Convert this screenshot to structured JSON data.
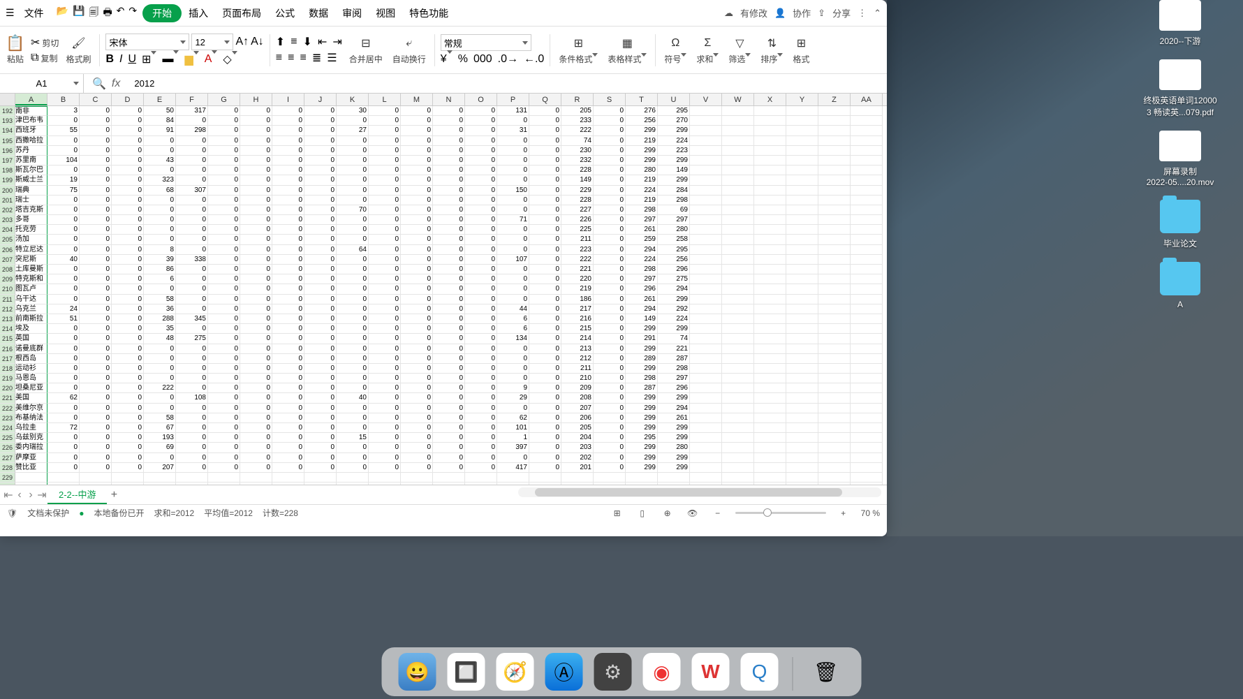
{
  "menu": {
    "file": "文件",
    "start": "开始",
    "insert": "插入",
    "layout": "页面布局",
    "formula": "公式",
    "data": "数据",
    "review": "审阅",
    "view": "视图",
    "feature": "特色功能",
    "hasChange": "有修改",
    "coop": "协作",
    "share": "分享"
  },
  "ribbon": {
    "paste": "粘贴",
    "cut": "剪切",
    "copy": "复制",
    "format": "格式刷",
    "font": "宋体",
    "size": "12",
    "merge": "合并居中",
    "wrap": "自动换行",
    "numfmt": "常规",
    "condfmt": "条件格式",
    "tablefmt": "表格样式",
    "symbol": "符号",
    "sum": "求和",
    "filter": "筛选",
    "sort": "排序",
    "fmt": "格式"
  },
  "namebox": "A1",
  "formula": "2012",
  "cols": [
    "A",
    "B",
    "C",
    "D",
    "E",
    "F",
    "G",
    "H",
    "I",
    "J",
    "K",
    "L",
    "M",
    "N",
    "O",
    "P",
    "Q",
    "R",
    "S",
    "T",
    "U",
    "V",
    "W",
    "X",
    "Y",
    "Z",
    "AA"
  ],
  "rowStart": 192,
  "rowData": [
    {
      "a": "南非",
      "v": [
        3,
        0,
        0,
        50,
        317,
        0,
        0,
        0,
        0,
        30,
        0,
        0,
        0,
        0,
        131,
        0,
        205,
        0,
        276,
        295
      ]
    },
    {
      "a": "津巴布韦",
      "v": [
        0,
        0,
        0,
        84,
        0,
        0,
        0,
        0,
        0,
        0,
        0,
        0,
        0,
        0,
        0,
        0,
        233,
        0,
        256,
        270
      ]
    },
    {
      "a": "西班牙",
      "v": [
        55,
        0,
        0,
        91,
        298,
        0,
        0,
        0,
        0,
        27,
        0,
        0,
        0,
        0,
        31,
        0,
        222,
        0,
        299,
        299
      ]
    },
    {
      "a": "西撒哈拉",
      "v": [
        0,
        0,
        0,
        0,
        0,
        0,
        0,
        0,
        0,
        0,
        0,
        0,
        0,
        0,
        0,
        0,
        74,
        0,
        219,
        224
      ]
    },
    {
      "a": "苏丹",
      "v": [
        0,
        0,
        0,
        0,
        0,
        0,
        0,
        0,
        0,
        0,
        0,
        0,
        0,
        0,
        0,
        0,
        230,
        0,
        299,
        223
      ]
    },
    {
      "a": "苏里南",
      "v": [
        104,
        0,
        0,
        43,
        0,
        0,
        0,
        0,
        0,
        0,
        0,
        0,
        0,
        0,
        0,
        0,
        232,
        0,
        299,
        299
      ]
    },
    {
      "a": "斯瓦尔巴",
      "v": [
        0,
        0,
        0,
        0,
        0,
        0,
        0,
        0,
        0,
        0,
        0,
        0,
        0,
        0,
        0,
        0,
        228,
        0,
        280,
        149
      ]
    },
    {
      "a": "斯威士兰",
      "v": [
        19,
        0,
        0,
        323,
        0,
        0,
        0,
        0,
        0,
        0,
        0,
        0,
        0,
        0,
        0,
        0,
        149,
        0,
        219,
        299
      ]
    },
    {
      "a": "瑞典",
      "v": [
        75,
        0,
        0,
        68,
        307,
        0,
        0,
        0,
        0,
        0,
        0,
        0,
        0,
        0,
        150,
        0,
        229,
        0,
        224,
        284
      ]
    },
    {
      "a": "瑞士",
      "v": [
        0,
        0,
        0,
        0,
        0,
        0,
        0,
        0,
        0,
        0,
        0,
        0,
        0,
        0,
        0,
        0,
        228,
        0,
        219,
        298
      ]
    },
    {
      "a": "塔吉克斯",
      "v": [
        0,
        0,
        0,
        0,
        0,
        0,
        0,
        0,
        0,
        70,
        0,
        0,
        0,
        0,
        0,
        0,
        227,
        0,
        298,
        69
      ]
    },
    {
      "a": "多哥",
      "v": [
        0,
        0,
        0,
        0,
        0,
        0,
        0,
        0,
        0,
        0,
        0,
        0,
        0,
        0,
        71,
        0,
        226,
        0,
        297,
        297
      ]
    },
    {
      "a": "托克劳",
      "v": [
        0,
        0,
        0,
        0,
        0,
        0,
        0,
        0,
        0,
        0,
        0,
        0,
        0,
        0,
        0,
        0,
        225,
        0,
        261,
        280
      ]
    },
    {
      "a": "汤加",
      "v": [
        0,
        0,
        0,
        0,
        0,
        0,
        0,
        0,
        0,
        0,
        0,
        0,
        0,
        0,
        0,
        0,
        211,
        0,
        259,
        258
      ]
    },
    {
      "a": "特立尼达",
      "v": [
        0,
        0,
        0,
        8,
        0,
        0,
        0,
        0,
        0,
        64,
        0,
        0,
        0,
        0,
        0,
        0,
        223,
        0,
        294,
        295
      ]
    },
    {
      "a": "突尼斯",
      "v": [
        40,
        0,
        0,
        39,
        338,
        0,
        0,
        0,
        0,
        0,
        0,
        0,
        0,
        0,
        107,
        0,
        222,
        0,
        224,
        256
      ]
    },
    {
      "a": "土库曼斯",
      "v": [
        0,
        0,
        0,
        86,
        0,
        0,
        0,
        0,
        0,
        0,
        0,
        0,
        0,
        0,
        0,
        0,
        221,
        0,
        298,
        296
      ]
    },
    {
      "a": "特克斯和",
      "v": [
        0,
        0,
        0,
        6,
        0,
        0,
        0,
        0,
        0,
        0,
        0,
        0,
        0,
        0,
        0,
        0,
        220,
        0,
        297,
        275
      ]
    },
    {
      "a": "图瓦卢",
      "v": [
        0,
        0,
        0,
        0,
        0,
        0,
        0,
        0,
        0,
        0,
        0,
        0,
        0,
        0,
        0,
        0,
        219,
        0,
        296,
        294
      ]
    },
    {
      "a": "乌干达",
      "v": [
        0,
        0,
        0,
        58,
        0,
        0,
        0,
        0,
        0,
        0,
        0,
        0,
        0,
        0,
        0,
        0,
        186,
        0,
        261,
        299
      ]
    },
    {
      "a": "乌克兰",
      "v": [
        24,
        0,
        0,
        36,
        0,
        0,
        0,
        0,
        0,
        0,
        0,
        0,
        0,
        0,
        44,
        0,
        217,
        0,
        294,
        292
      ]
    },
    {
      "a": "前南斯拉",
      "v": [
        51,
        0,
        0,
        288,
        345,
        0,
        0,
        0,
        0,
        0,
        0,
        0,
        0,
        0,
        6,
        0,
        216,
        0,
        149,
        224
      ]
    },
    {
      "a": "埃及",
      "v": [
        0,
        0,
        0,
        35,
        0,
        0,
        0,
        0,
        0,
        0,
        0,
        0,
        0,
        0,
        6,
        0,
        215,
        0,
        299,
        299
      ]
    },
    {
      "a": "英国",
      "v": [
        0,
        0,
        0,
        48,
        275,
        0,
        0,
        0,
        0,
        0,
        0,
        0,
        0,
        0,
        134,
        0,
        214,
        0,
        291,
        74
      ]
    },
    {
      "a": "诺曼底群",
      "v": [
        0,
        0,
        0,
        0,
        0,
        0,
        0,
        0,
        0,
        0,
        0,
        0,
        0,
        0,
        0,
        0,
        213,
        0,
        299,
        221
      ]
    },
    {
      "a": "根西岛",
      "v": [
        0,
        0,
        0,
        0,
        0,
        0,
        0,
        0,
        0,
        0,
        0,
        0,
        0,
        0,
        0,
        0,
        212,
        0,
        289,
        287
      ]
    },
    {
      "a": "运动衫",
      "v": [
        0,
        0,
        0,
        0,
        0,
        0,
        0,
        0,
        0,
        0,
        0,
        0,
        0,
        0,
        0,
        0,
        211,
        0,
        299,
        298
      ]
    },
    {
      "a": "马恩岛",
      "v": [
        0,
        0,
        0,
        0,
        0,
        0,
        0,
        0,
        0,
        0,
        0,
        0,
        0,
        0,
        0,
        0,
        210,
        0,
        298,
        297
      ]
    },
    {
      "a": "坦桑尼亚",
      "v": [
        0,
        0,
        0,
        222,
        0,
        0,
        0,
        0,
        0,
        0,
        0,
        0,
        0,
        0,
        9,
        0,
        209,
        0,
        287,
        296
      ]
    },
    {
      "a": "美国",
      "v": [
        62,
        0,
        0,
        0,
        108,
        0,
        0,
        0,
        0,
        40,
        0,
        0,
        0,
        0,
        29,
        0,
        208,
        0,
        299,
        299
      ]
    },
    {
      "a": "美维尔京",
      "v": [
        0,
        0,
        0,
        0,
        0,
        0,
        0,
        0,
        0,
        0,
        0,
        0,
        0,
        0,
        0,
        0,
        207,
        0,
        299,
        294
      ]
    },
    {
      "a": "布基纳法",
      "v": [
        0,
        0,
        0,
        58,
        0,
        0,
        0,
        0,
        0,
        0,
        0,
        0,
        0,
        0,
        62,
        0,
        206,
        0,
        299,
        261
      ]
    },
    {
      "a": "乌拉圭",
      "v": [
        72,
        0,
        0,
        67,
        0,
        0,
        0,
        0,
        0,
        0,
        0,
        0,
        0,
        0,
        101,
        0,
        205,
        0,
        299,
        299
      ]
    },
    {
      "a": "乌兹别克",
      "v": [
        0,
        0,
        0,
        193,
        0,
        0,
        0,
        0,
        0,
        15,
        0,
        0,
        0,
        0,
        1,
        0,
        204,
        0,
        295,
        299
      ]
    },
    {
      "a": "委内瑞拉",
      "v": [
        0,
        0,
        0,
        69,
        0,
        0,
        0,
        0,
        0,
        0,
        0,
        0,
        0,
        0,
        397,
        0,
        203,
        0,
        299,
        280
      ]
    },
    {
      "a": "萨摩亚",
      "v": [
        0,
        0,
        0,
        0,
        0,
        0,
        0,
        0,
        0,
        0,
        0,
        0,
        0,
        0,
        0,
        0,
        202,
        0,
        299,
        299
      ]
    },
    {
      "a": "赞比亚",
      "v": [
        0,
        0,
        0,
        207,
        0,
        0,
        0,
        0,
        0,
        0,
        0,
        0,
        0,
        0,
        417,
        0,
        201,
        0,
        299,
        299
      ]
    },
    {
      "a": "",
      "v": [
        "",
        "",
        "",
        "",
        "",
        "",
        "",
        "",
        "",
        "",
        "",
        "",
        "",
        "",
        "",
        "",
        "",
        "",
        "",
        ""
      ]
    },
    {
      "a": "",
      "v": [
        "",
        "",
        "",
        "",
        "",
        "",
        "",
        "",
        "",
        "",
        "",
        "",
        "",
        "",
        "",
        "",
        "",
        "",
        "",
        ""
      ]
    }
  ],
  "sheet": "2-2--中游",
  "status": {
    "protect": "文档未保护",
    "backup": "本地备份已开",
    "sum": "求和=2012",
    "avg": "平均值=2012",
    "count": "计数=228",
    "zoom": "70 %"
  },
  "desktop": [
    {
      "name": "2020--下游",
      "type": "thumb"
    },
    {
      "name": "终极英语单词12000\n3 畅读英...079.pdf",
      "type": "thumb"
    },
    {
      "name": "屏幕录制\n2022-05....20.mov",
      "type": "thumb"
    },
    {
      "name": "毕业论文",
      "type": "folder"
    },
    {
      "name": "A",
      "type": "folder"
    }
  ]
}
